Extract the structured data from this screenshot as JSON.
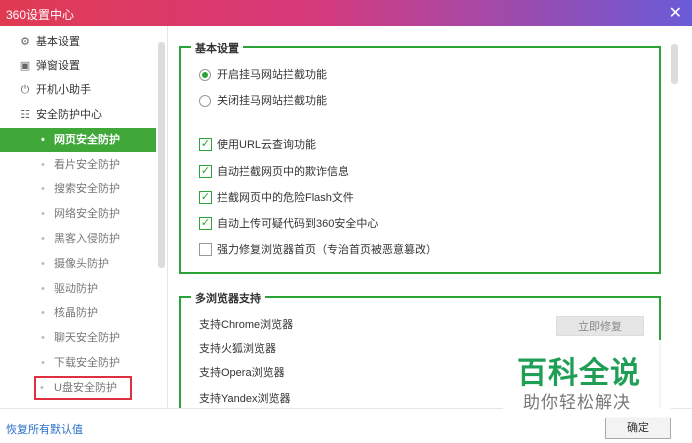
{
  "window": {
    "title": "360设置中心",
    "close_icon": "close-icon"
  },
  "sidebar": {
    "top_items": [
      {
        "label": "基本设置",
        "icon": "gear-icon"
      },
      {
        "label": "弹窗设置",
        "icon": "window-icon"
      },
      {
        "label": "开机小助手",
        "icon": "power-icon"
      },
      {
        "label": "安全防护中心",
        "icon": "shield-grid-icon"
      }
    ],
    "sub_items": [
      {
        "label": "网页安全防护",
        "active": true
      },
      {
        "label": "看片安全防护"
      },
      {
        "label": "搜索安全防护"
      },
      {
        "label": "网络安全防护"
      },
      {
        "label": "黑客入侵防护"
      },
      {
        "label": "摄像头防护"
      },
      {
        "label": "驱动防护"
      },
      {
        "label": "核晶防护"
      },
      {
        "label": "聊天安全防护"
      },
      {
        "label": "下载安全防护"
      },
      {
        "label": "U盘安全防护",
        "highlighted": true
      }
    ]
  },
  "basic_group": {
    "title": "基本设置",
    "radios": [
      {
        "label": "开启挂马网站拦截功能",
        "checked": true
      },
      {
        "label": "关闭挂马网站拦截功能",
        "checked": false
      }
    ],
    "checkboxes": [
      {
        "label": "使用URL云查询功能",
        "checked": true
      },
      {
        "label": "自动拦截网页中的欺诈信息",
        "checked": true
      },
      {
        "label": "拦截网页中的危险Flash文件",
        "checked": true
      },
      {
        "label": "自动上传可疑代码到360安全中心",
        "checked": true
      },
      {
        "label": "强力修复浏览器首页（专治首页被恶意篡改）",
        "checked": false
      }
    ]
  },
  "browser_group": {
    "title": "多浏览器支持",
    "items": [
      "支持Chrome浏览器",
      "支持火狐浏览器",
      "支持Opera浏览器",
      "支持Yandex浏览器"
    ],
    "repair_label": "立即修复"
  },
  "footer": {
    "reset_label": "恢复所有默认值",
    "ok_label": "确定"
  },
  "watermark": {
    "title": "百科全说",
    "subtitle": "助你轻松解决"
  },
  "colors": {
    "accent": "#2aa339",
    "active_bg": "#3fa838",
    "highlight": "#e0303f",
    "link": "#2a6fc9"
  }
}
